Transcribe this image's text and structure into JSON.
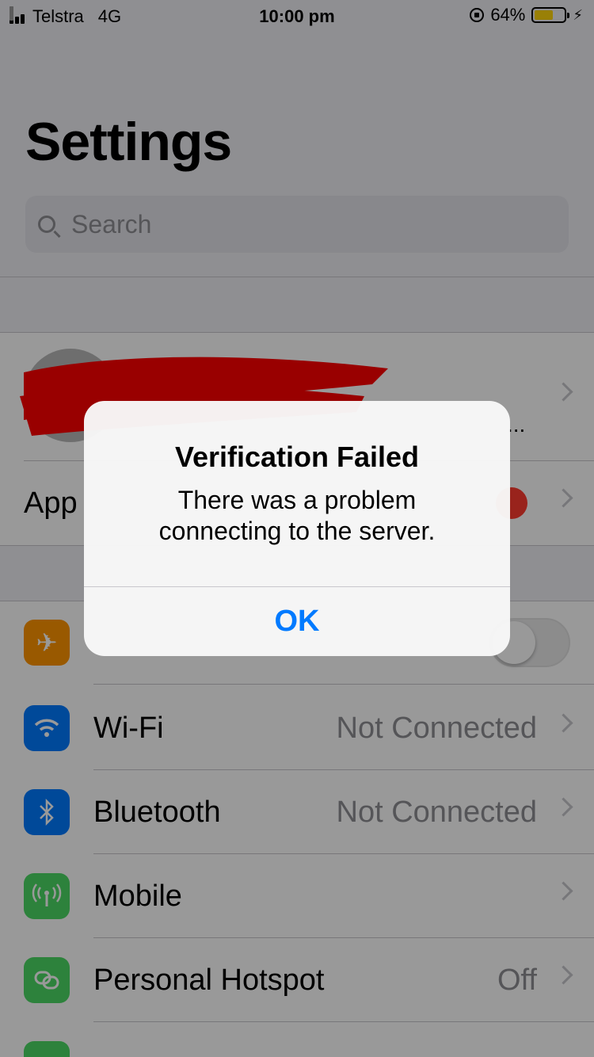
{
  "status_bar": {
    "carrier": "Telstra",
    "network": "4G",
    "time": "10:00 pm",
    "battery_percent": "64%",
    "battery_level": 0.64
  },
  "header": {
    "title": "Settings",
    "search_placeholder": "Search"
  },
  "profile_row": {
    "label_fragment": "..."
  },
  "app_row": {
    "label": "App"
  },
  "settings_rows": [
    {
      "icon": "airplane-icon",
      "label": "",
      "value": "",
      "color": "#ff9500"
    },
    {
      "icon": "wifi-icon",
      "label": "Wi-Fi",
      "value": "Not Connected",
      "color": "#007aff"
    },
    {
      "icon": "bluetooth-icon",
      "label": "Bluetooth",
      "value": "Not Connected",
      "color": "#007aff"
    },
    {
      "icon": "antenna-icon",
      "label": "Mobile",
      "value": "",
      "color": "#4cd964"
    },
    {
      "icon": "hotspot-icon",
      "label": "Personal Hotspot",
      "value": "Off",
      "color": "#4cd964"
    }
  ],
  "alert": {
    "title": "Verification Failed",
    "message": "There was a problem connecting to the server.",
    "ok_label": "OK"
  },
  "colors": {
    "accent": "#007aff",
    "scribble": "#ff0000",
    "dim_overlay": "rgba(0,0,0,0.40)"
  }
}
